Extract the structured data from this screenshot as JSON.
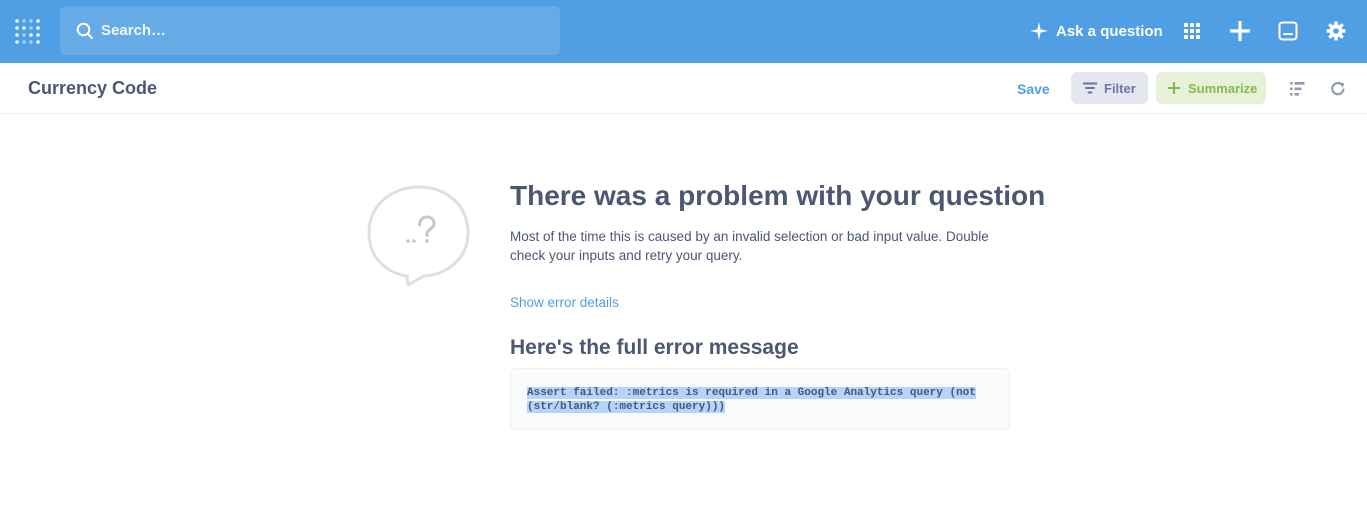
{
  "navbar": {
    "search": {
      "placeholder": "Search…"
    },
    "ask_label": "Ask a question",
    "icons": [
      "logo-icon",
      "search-icon",
      "sparkle-icon",
      "grid-icon",
      "plus-icon",
      "terminal-icon",
      "gear-icon"
    ]
  },
  "question_bar": {
    "title": "Currency Code",
    "save_label": "Save",
    "filter_label": "Filter",
    "summarize_label": "Summarize"
  },
  "error": {
    "title": "There was a problem with your question",
    "description": "Most of the time this is caused by an invalid selection or bad input value. Double check your inputs and retry your query.",
    "details_link": "Show error details",
    "full_message_heading": "Here's the full error message",
    "message_line1": "Assert failed: :metrics is required in a Google Analytics query (not",
    "message_line2": "(str/blank? (:metrics query)))"
  },
  "colors": {
    "brand": "#509ee3",
    "text_dark": "#4c5773",
    "filter": "#7172ad",
    "summarize": "#84bb4c",
    "selection": "#b3d4fc"
  }
}
